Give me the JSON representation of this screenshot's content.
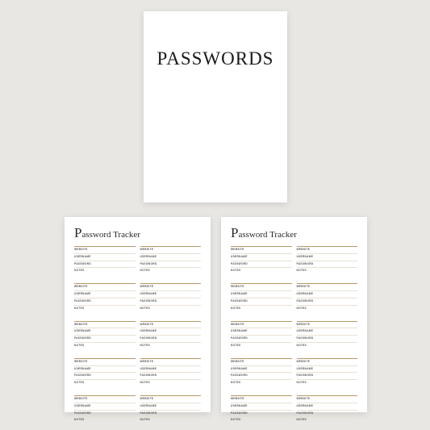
{
  "cover": {
    "title": "PASSWORDS"
  },
  "tracker": {
    "title_prefix": "P",
    "title_rest": "assword Tracker",
    "labels": {
      "website": "WEBSITE",
      "username": "USERNAME",
      "password": "PASSWORD",
      "notes": "NOTES"
    },
    "entry_count": 10
  }
}
